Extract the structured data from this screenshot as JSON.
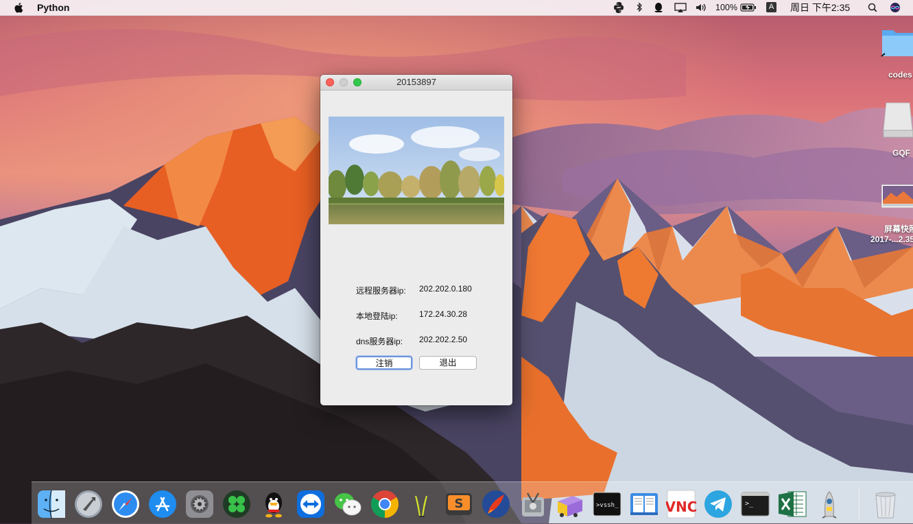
{
  "menubar": {
    "apple_icon": "apple-icon",
    "app_name": "Python",
    "battery": "100%",
    "input_source": "A",
    "clock": "周日 下午2:35"
  },
  "desktop": {
    "items": [
      {
        "label": "codes",
        "icon": "folder-icon"
      },
      {
        "label": "GQF",
        "icon": "drive-icon"
      },
      {
        "label_line1": "屏幕快照",
        "label_line2": "2017-...2.35",
        "icon": "screenshot-icon"
      }
    ]
  },
  "window": {
    "title": "20153897",
    "rows": [
      {
        "label": "远程服务器ip:",
        "value": "202.202.0.180"
      },
      {
        "label": "本地登陆ip:",
        "value": "172.24.30.28"
      },
      {
        "label": "dns服务器ip:",
        "value": "202.202.2.50"
      }
    ],
    "buttons": {
      "logout": "注销",
      "quit": "退出"
    }
  },
  "dock": {
    "apps": [
      "finder-icon",
      "launchpad-icon",
      "safari-icon",
      "app-store-icon",
      "system-preferences-icon",
      "clover-icon",
      "qq-icon",
      "teamviewer-icon",
      "wechat-icon",
      "chrome-icon",
      "transmit-icon",
      "sublime-text-icon",
      "rocket-icon",
      "disk-utility-icon",
      "transmit-truck-icon",
      "vssh-icon",
      "book-icon",
      "vnc-viewer-icon",
      "telegram-icon",
      "terminal-icon",
      "excel-icon",
      "python-launcher-icon",
      "trash-icon"
    ],
    "vssh_label": ">vssh_",
    "vnc_label": "VNC",
    "terminal_label": ">_"
  }
}
